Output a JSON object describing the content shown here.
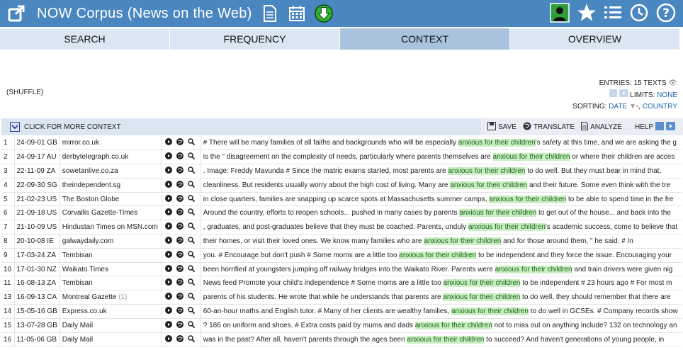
{
  "app": {
    "title": "NOW Corpus (News on the Web)"
  },
  "tabs": [
    {
      "label": "SEARCH"
    },
    {
      "label": "FREQUENCY"
    },
    {
      "label": "CONTEXT",
      "active": true
    },
    {
      "label": "OVERVIEW"
    }
  ],
  "entries": {
    "label": "ENTRIES: 15 TEXTS",
    "limits_label": "LIMITS:",
    "limits_value": "NONE",
    "sorting_label": "SORTING:",
    "sort_date": "DATE",
    "sort_sep": "-,",
    "sort_country": "COUNTRY"
  },
  "shuffle": "(SHUFFLE)",
  "context_bar": {
    "more": "CLICK FOR MORE CONTEXT",
    "save": "SAVE",
    "translate": "TRANSLATE",
    "analyze": "ANALYZE",
    "help": "HELP"
  },
  "colors": {
    "topbar": "#4a86c0",
    "highlight": "#c8f0c0",
    "tab_active": "#a9c3de"
  },
  "rows": [
    {
      "n": "1",
      "date": "24-09-01 GB",
      "source": "mirror.co.uk",
      "pre": "# There will be many families of all faiths and backgrounds who will be especially ",
      "kw": [
        "anxious",
        "for",
        "their",
        "children"
      ],
      "post": "'s safety at this time, and we are asking the g"
    },
    {
      "n": "2",
      "date": "24-09-17 AU",
      "source": "derbytelegraph.co.uk",
      "pre": "is the \" disagreement on the complexity of needs, particularly where parents themselves are ",
      "kw": [
        "anxious",
        "for",
        "their",
        "children"
      ],
      "post": " or where their children are acces"
    },
    {
      "n": "3",
      "date": "22-11-09 ZA",
      "source": "sowetanlive.co.za",
      "pre": ". Image: Freddy Mavunda # Since the matric exams started, most parents are ",
      "kw": [
        "anxious",
        "for",
        "their",
        "children"
      ],
      "post": " to do well. But they must bear in mind that,"
    },
    {
      "n": "4",
      "date": "22-09-30 SG",
      "source": "theindependent.sg",
      "pre": "cleanliness. But residents usually worry about the high cost of living. Many are ",
      "kw": [
        "anxious",
        "for",
        "their",
        "children"
      ],
      "post": " and their future. Some even think with the tre"
    },
    {
      "n": "5",
      "date": "21-02-23 US",
      "source": "The Boston Globe",
      "pre": "in close quarters, families are snapping up scarce spots at Massachusetts summer camps, ",
      "kw": [
        "anxious",
        "for",
        "their",
        "children"
      ],
      "post": " to be able to spend time in the fre"
    },
    {
      "n": "6",
      "date": "21-09-18 US",
      "source": "Corvallis Gazette-Times",
      "pre": "Around the country, efforts to reopen schools... pushed in many cases by parents ",
      "kw": [
        "anxious",
        "for",
        "their",
        "children"
      ],
      "post": " to get out of the house... and back into the"
    },
    {
      "n": "7",
      "date": "21-10-09 US",
      "source": "Hindustan Times on MSN.com",
      "pre": ", graduates, and post-graduates believe that they must be coached. Parents, unduly ",
      "kw": [
        "anxious",
        "for",
        "their",
        "children"
      ],
      "post": "'s academic success, come to believe that"
    },
    {
      "n": "8",
      "date": "20-10-08 IE",
      "source": "galwaydaily.com",
      "pre": "their homes, or visit their loved ones. We know many families who are ",
      "kw": [
        "anxious",
        "for",
        "their",
        "children"
      ],
      "post": " and for those around them, \" he said. # In"
    },
    {
      "n": "9",
      "date": "17-03-24 ZA",
      "source": "Tembisan",
      "pre": "you. # Encourage but don't push # Some moms are a little too ",
      "kw": [
        "anxious",
        "for",
        "their",
        "children"
      ],
      "post": " to be independent and they force the issue. Encouraging your"
    },
    {
      "n": "10",
      "date": "17-01-30 NZ",
      "source": "Waikato Times",
      "pre": "been horrified at youngsters jumping off railway bridges into the Waikato River. Parents were ",
      "kw": [
        "anxious",
        "for",
        "their",
        "children"
      ],
      "post": " and train drivers were given nig"
    },
    {
      "n": "11",
      "date": "16-08-13 ZA",
      "source": "Tembisan",
      "pre": "News feed Promote your child's independence # Some moms are a little too ",
      "kw": [
        "anxious",
        "for",
        "their",
        "children"
      ],
      "post": " to be independent # 23 hours ago # For most m"
    },
    {
      "n": "13",
      "date": "16-09-13 CA",
      "source": "Montreal Gazette",
      "source_extra": "(1)",
      "pre": "parents of his students. He wrote that while he understands that parents are ",
      "kw": [
        "anxious",
        "for",
        "their",
        "children"
      ],
      "post": " to do well, they should remember that there are"
    },
    {
      "n": "14",
      "date": "15-05-16 GB",
      "source": "Express.co.uk",
      "pre": "60-an-hour maths and English tutor. # Many of her clients are wealthy families, ",
      "kw": [
        "anxious",
        "for",
        "their",
        "children"
      ],
      "post": " to do well in GCSEs. # Company records show"
    },
    {
      "n": "15",
      "date": "13-07-28 GB",
      "source": "Daily Mail",
      "pre": "? 186 on uniform and shoes. # Extra costs paid by mums and dads ",
      "kw": [
        "anxious",
        "for",
        "their",
        "children"
      ],
      "post": " not to miss out on anything include? 132 on technology an"
    },
    {
      "n": "16",
      "date": "11-05-06 GB",
      "source": "Daily Mail",
      "pre": "was in the past? After all, haven't parents through the ages been ",
      "kw": [
        "anxious",
        "for",
        "their",
        "children"
      ],
      "post": " to succeed? And haven't generations of young people, in"
    }
  ]
}
